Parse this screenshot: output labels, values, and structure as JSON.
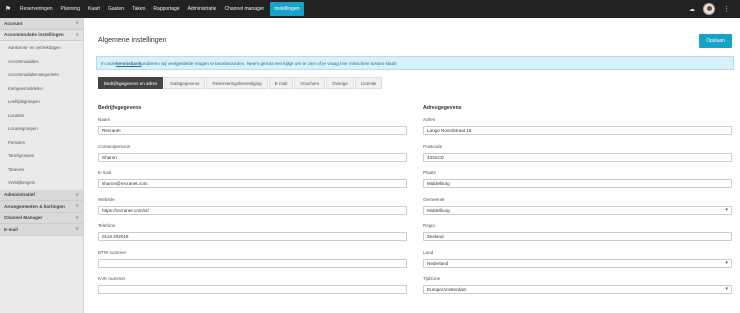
{
  "topbar": {
    "home_icon": "home-icon",
    "nav": [
      "Reserveringen",
      "Planning",
      "Kaart",
      "Gasten",
      "Taken",
      "Rapportage",
      "Administratie",
      "Channel manager",
      "Instellingen"
    ],
    "active": "Instellingen",
    "icons": [
      "cloud-upload-icon",
      "avatar",
      "kebab-menu-icon"
    ]
  },
  "sidebar": {
    "sections": [
      {
        "label": "Account",
        "open": false
      },
      {
        "label": "Accommodatie instellingen",
        "open": true,
        "items": [
          "Aankomst- en vertrekdagen",
          "Accommodaties",
          "Accommodatiecategorieën",
          "Kampeermiddelen",
          "Leeftijdsgroepen",
          "Locaties",
          "Locatiegroepen",
          "Periodes",
          "Tariefgroepen",
          "Tarieven",
          "Verblijfsregels"
        ]
      },
      {
        "label": "Administratief",
        "open": false
      },
      {
        "label": "Arrangementen & kortingen",
        "open": false
      },
      {
        "label": "Channel Manager",
        "open": false
      },
      {
        "label": "E-mail",
        "open": false
      }
    ]
  },
  "main": {
    "title": "Algemene instellingen",
    "save_label": "Opslaan",
    "alert_pre": "In onze ",
    "alert_link": "kennisbank",
    "alert_post": " proberen wij veelgestelde vragen te beantwoorden. Neem gerust een kijkje om te zien of je vraag hier misschien tussen staat!",
    "tabs": [
      "Bedrijfsgegevens en adres",
      "Gastgegevens",
      "Reserveringsbevestiging",
      "E-mail",
      "Vouchers",
      "Overige",
      "Licentie"
    ],
    "active_tab": "Bedrijfsgegevens en adres",
    "left_section": "Bedrijfsgegevens",
    "right_section": "Adresgegevens",
    "left_fields": [
      {
        "label": "Naam",
        "value": "Recranet"
      },
      {
        "label": "Contactpersoon",
        "value": "Sharon"
      },
      {
        "label": "E-mail",
        "value": "sharon@recranet.com"
      },
      {
        "label": "Website",
        "value": "https://recranet.com/nl/"
      },
      {
        "label": "Telefoon",
        "value": "0118 202019"
      },
      {
        "label": "BTW nummer",
        "value": ""
      },
      {
        "label": "KVK nummer",
        "value": ""
      }
    ],
    "right_fields": [
      {
        "label": "Adres",
        "value": "Lange Noordstraat 16",
        "select": false
      },
      {
        "label": "Postcode",
        "value": "4331CD",
        "select": false
      },
      {
        "label": "Plaats",
        "value": "Middelburg",
        "select": false
      },
      {
        "label": "Gemeente",
        "value": "Middelburg",
        "select": true
      },
      {
        "label": "Regio",
        "value": "Zeeland",
        "select": false
      },
      {
        "label": "Land",
        "value": "Nederland",
        "select": true
      },
      {
        "label": "Tijdzone",
        "value": "Europe/Amsterdam",
        "select": true
      }
    ],
    "accent_color": "#17a2c8"
  }
}
